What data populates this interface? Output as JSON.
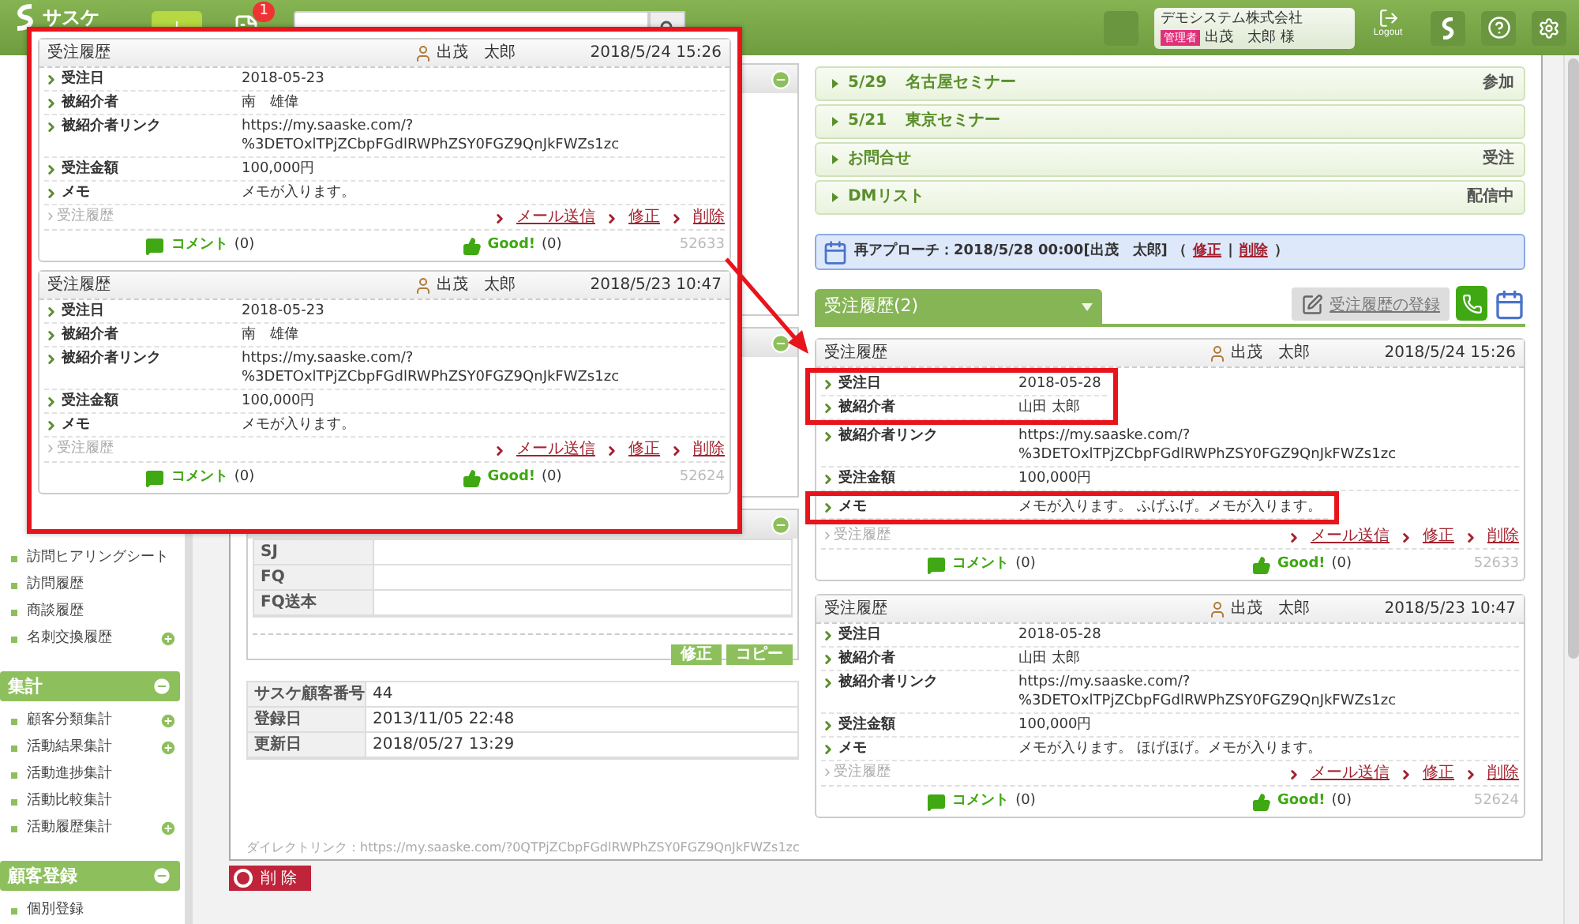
{
  "header": {
    "logo": "サスケ",
    "notification_count": "1",
    "user": {
      "company": "デモシステム株式会社",
      "role": "管理者",
      "name": "出茂　太郎 様"
    },
    "logout": "Logout"
  },
  "sidebar": {
    "groups": [
      {
        "items": [
          {
            "label": "訪問ヒアリングシート",
            "addable": false
          },
          {
            "label": "訪問履歴",
            "addable": false
          },
          {
            "label": "商談履歴",
            "addable": false
          },
          {
            "label": "名刺交換履歴",
            "addable": true
          }
        ]
      },
      {
        "title": "集計",
        "expanded": true,
        "items": [
          {
            "label": "顧客分類集計",
            "addable": true
          },
          {
            "label": "活動結果集計",
            "addable": true
          },
          {
            "label": "活動進捗集計",
            "addable": false
          },
          {
            "label": "活動比較集計",
            "addable": false
          },
          {
            "label": "活動履歴集計",
            "addable": true
          }
        ]
      },
      {
        "title": "顧客登録",
        "expanded": true,
        "items": [
          {
            "label": "個別登録",
            "addable": false
          }
        ]
      }
    ]
  },
  "left_panels": [
    {
      "expanded": true
    },
    {
      "expanded": true
    },
    {
      "expanded": true,
      "rows": [
        {
          "label": "SJ"
        },
        {
          "label": "FQ"
        },
        {
          "label": "FQ送本"
        }
      ],
      "buttons": [
        "修正",
        "コピー"
      ]
    }
  ],
  "info_table": [
    {
      "label": "サスケ顧客番号",
      "value": "44"
    },
    {
      "label": "登録日",
      "value": "2013/11/05 22:48"
    },
    {
      "label": "更新日",
      "value": "2018/05/27 13:29"
    }
  ],
  "direct_link": {
    "label": "ダイレクトリンク：",
    "url": "https://my.saaske.com/?0QTPjZCbpFGdlRWPhZSY0FGZ9QnJkFWZs1zc"
  },
  "delete_button": "削 除",
  "events": [
    {
      "date": "5/29",
      "title": "名古屋セミナー",
      "status": "参加"
    },
    {
      "date": "5/21",
      "title": "東京セミナー"
    },
    {
      "title": "お問合せ",
      "status": "受注"
    },
    {
      "title": "DMリスト",
      "status": "配信中"
    }
  ],
  "reapproach": {
    "text": "再アプローチ：2018/5/28 00:00[出茂　太郎] （",
    "links": [
      "修正",
      "削除"
    ],
    "separator": "|",
    "suffix": "）"
  },
  "tab": {
    "label": "受注履歴(2)",
    "selected": true
  },
  "register_button": "受注履歴の登録",
  "records": [
    {
      "type": "受注履歴",
      "user": "出茂　太郎",
      "datetime": "2018/5/24 15:26",
      "fields": [
        {
          "label": "受注日",
          "value": "2018-05-28",
          "highlighted": true
        },
        {
          "label": "被紹介者",
          "value": "山田 太郎",
          "highlighted": true
        },
        {
          "label": "被紹介者リンク",
          "value": "https://my.saaske.com/?\n%3DETOxlTPjZCbpFGdlRWPhZSY0FGZ9QnJkFWZs1zc",
          "highlighted": false
        },
        {
          "label": "受注金額",
          "value": "100,000円",
          "highlighted": false
        },
        {
          "label": "メモ",
          "value": "メモが入ります。 ふげふげ。メモが入ります。",
          "highlighted": true
        }
      ],
      "category": "受注履歴",
      "actions": [
        "メール送信",
        "修正",
        "削除"
      ],
      "comment_label": "コメント",
      "comment_count": "(0)",
      "good_label": "Good!",
      "good_count": "(0)",
      "id": "52633"
    },
    {
      "type": "受注履歴",
      "user": "出茂　太郎",
      "datetime": "2018/5/23 10:47",
      "fields": [
        {
          "label": "受注日",
          "value": "2018-05-28",
          "highlighted": false
        },
        {
          "label": "被紹介者",
          "value": "山田 太郎",
          "highlighted": false
        },
        {
          "label": "被紹介者リンク",
          "value": "https://my.saaske.com/?\n%3DETOxlTPjZCbpFGdlRWPhZSY0FGZ9QnJkFWZs1zc",
          "highlighted": false
        },
        {
          "label": "受注金額",
          "value": "100,000円",
          "highlighted": false
        },
        {
          "label": "メモ",
          "value": "メモが入ります。 ほげほげ。メモが入ります。",
          "highlighted": false
        }
      ],
      "category": "受注履歴",
      "actions": [
        "メール送信",
        "修正",
        "削除"
      ],
      "comment_label": "コメント",
      "comment_count": "(0)",
      "good_label": "Good!",
      "good_count": "(0)",
      "id": "52624"
    }
  ],
  "callout": {
    "records": [
      {
        "type": "受注履歴",
        "user": "出茂　太郎",
        "datetime": "2018/5/24 15:26",
        "fields": [
          {
            "label": "受注日",
            "value": "2018-05-23"
          },
          {
            "label": "被紹介者",
            "value": "南　雄偉"
          },
          {
            "label": "被紹介者リンク",
            "value": "https://my.saaske.com/?\n%3DETOxlTPjZCbpFGdlRWPhZSY0FGZ9QnJkFWZs1zc"
          },
          {
            "label": "受注金額",
            "value": "100,000円"
          },
          {
            "label": "メモ",
            "value": "メモが入ります。"
          }
        ],
        "category": "受注履歴",
        "actions": [
          "メール送信",
          "修正",
          "削除"
        ],
        "comment_label": "コメント",
        "comment_count": "(0)",
        "good_label": "Good!",
        "good_count": "(0)",
        "id": "52633"
      },
      {
        "type": "受注履歴",
        "user": "出茂　太郎",
        "datetime": "2018/5/23 10:47",
        "fields": [
          {
            "label": "受注日",
            "value": "2018-05-23"
          },
          {
            "label": "被紹介者",
            "value": "南　雄偉"
          },
          {
            "label": "被紹介者リンク",
            "value": "https://my.saaske.com/?\n%3DETOxlTPjZCbpFGdlRWPhZSY0FGZ9QnJkFWZs1zc"
          },
          {
            "label": "受注金額",
            "value": "100,000円"
          },
          {
            "label": "メモ",
            "value": "メモが入ります。"
          }
        ],
        "category": "受注履歴",
        "actions": [
          "メール送信",
          "修正",
          "削除"
        ],
        "comment_label": "コメント",
        "comment_count": "(0)",
        "good_label": "Good!",
        "good_count": "(0)",
        "id": "52624"
      }
    ]
  }
}
